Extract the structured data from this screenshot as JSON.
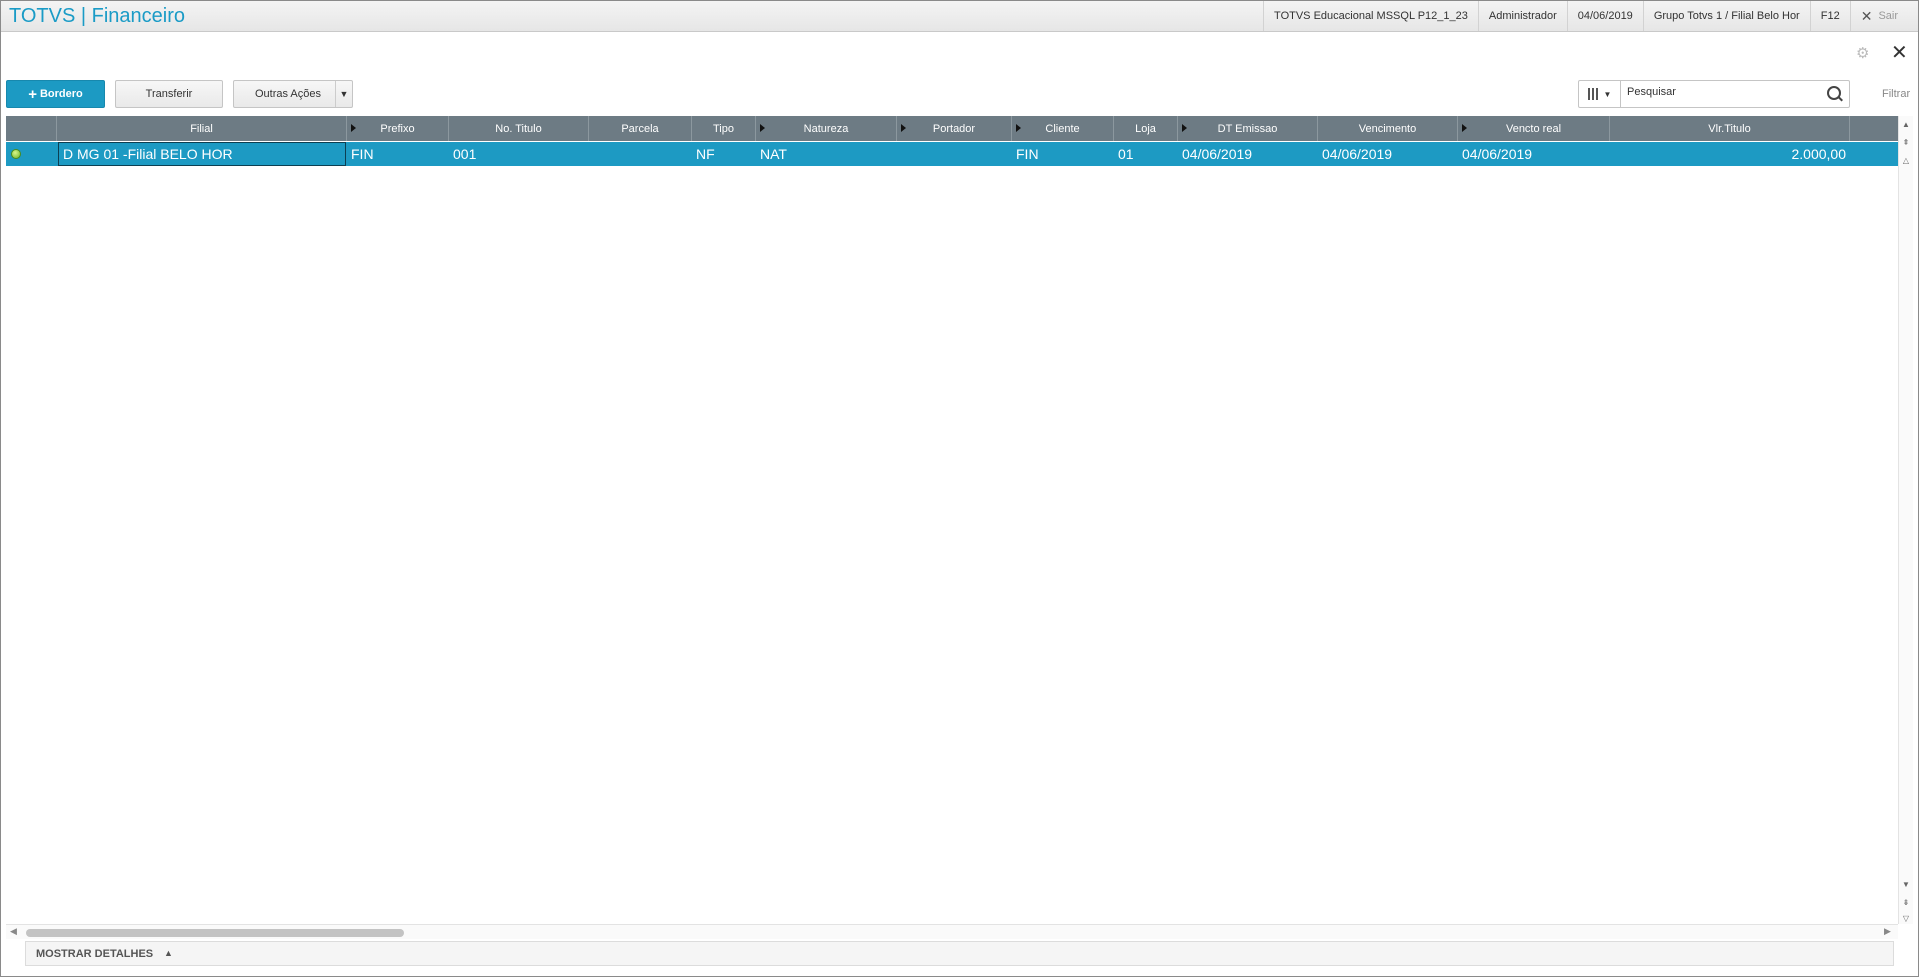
{
  "app": {
    "title": "TOTVS | Financeiro"
  },
  "top_info": {
    "environment": "TOTVS Educacional MSSQL P12_1_23",
    "user": "Administrador",
    "date": "04/06/2019",
    "branch": "Grupo Totvs 1 / Filial Belo Hor",
    "shortcut": "F12",
    "exit_label": "Sair"
  },
  "toolbar": {
    "primary_label": "Bordero",
    "transfer_label": "Transferir",
    "more_label": "Outras Ações"
  },
  "search": {
    "placeholder": "Pesquisar",
    "filter_label": "Filtrar"
  },
  "grid": {
    "columns": [
      "Filial",
      "Prefixo",
      "No. Titulo",
      "Parcela",
      "Tipo",
      "Natureza",
      "Portador",
      "Cliente",
      "Loja",
      "DT Emissao",
      "Vencimento",
      "Vencto real",
      "Vlr.Titulo"
    ],
    "rows": [
      {
        "status": "green",
        "filial": "D MG 01 -Filial BELO HOR",
        "prefixo": "FIN",
        "no_titulo": "001",
        "parcela": "",
        "tipo": "NF",
        "natureza": "NAT",
        "portador": "",
        "cliente": "FIN",
        "loja": "01",
        "dt_emissao": "04/06/2019",
        "vencimento": "04/06/2019",
        "vencto_real": "04/06/2019",
        "vlr_titulo": "2.000,00"
      }
    ]
  },
  "footer": {
    "details_label": "MOSTRAR DETALHES"
  },
  "colors": {
    "accent": "#1c9ac3",
    "header_bg": "#6d7b84",
    "status_ok": "#6fb32a"
  }
}
